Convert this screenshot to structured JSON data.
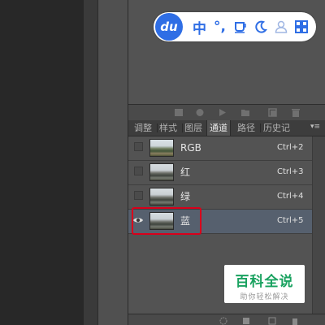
{
  "ime_toolbar": {
    "logo": "du",
    "items": [
      "中",
      "°,",
      "cup-icon",
      "moon-icon",
      "user-icon",
      "grid-icon"
    ],
    "lang": "中",
    "punct": "°,"
  },
  "panel": {
    "tabs": [
      {
        "label": "调整"
      },
      {
        "label": "样式"
      },
      {
        "label": "图层"
      },
      {
        "label": "通道"
      },
      {
        "label": "路径"
      },
      {
        "label": "历史记"
      }
    ],
    "active_tab": "通道",
    "channels": [
      {
        "label": "RGB",
        "shortcut": "Ctrl+2",
        "visible": false,
        "selected": false
      },
      {
        "label": "红",
        "shortcut": "Ctrl+3",
        "visible": false,
        "selected": false
      },
      {
        "label": "绿",
        "shortcut": "Ctrl+4",
        "visible": false,
        "selected": false
      },
      {
        "label": "蓝",
        "shortcut": "Ctrl+5",
        "visible": true,
        "selected": true
      }
    ]
  },
  "watermark": {
    "title": "百科全说",
    "subtitle": "助你轻松解决"
  },
  "colors": {
    "accent": "#2f6ee5",
    "selection": "#56606e",
    "highlight_border": "#d9001b",
    "watermark_green": "#1aa260"
  }
}
